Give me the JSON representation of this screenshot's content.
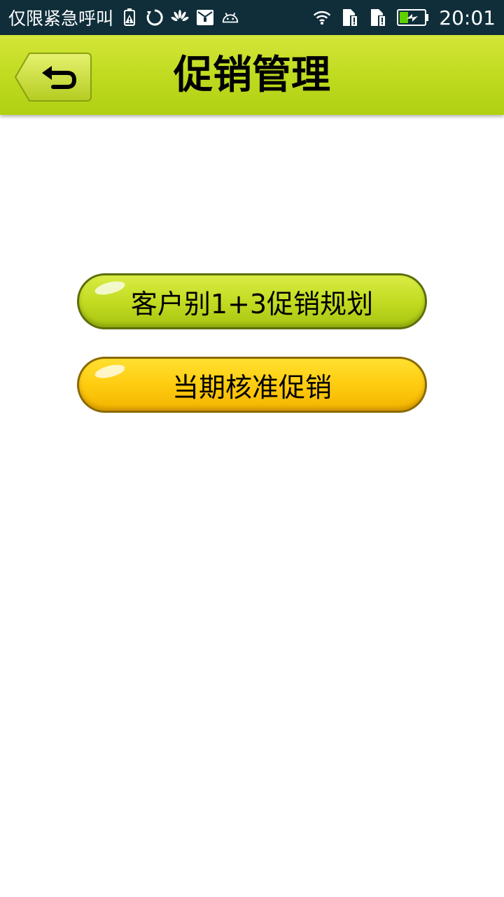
{
  "status_bar": {
    "carrier_text": "仅限紧急呼叫",
    "time": "20:01",
    "left_icons": [
      "battery-alert-icon",
      "sync-icon",
      "huawei-icon",
      "mail-icon",
      "android-icon"
    ],
    "right_icons": [
      "wifi-icon",
      "sim1-alert-icon",
      "sim2-alert-icon",
      "battery-charging-icon"
    ]
  },
  "header": {
    "title": "促销管理",
    "back_icon": "back-arrow-icon",
    "color": "#c2dc22"
  },
  "menu": {
    "items": [
      {
        "label": "客户别1+3促销规划",
        "color": "#c3dc22"
      },
      {
        "label": "当期核准促销",
        "color": "#ffcc10"
      }
    ]
  }
}
